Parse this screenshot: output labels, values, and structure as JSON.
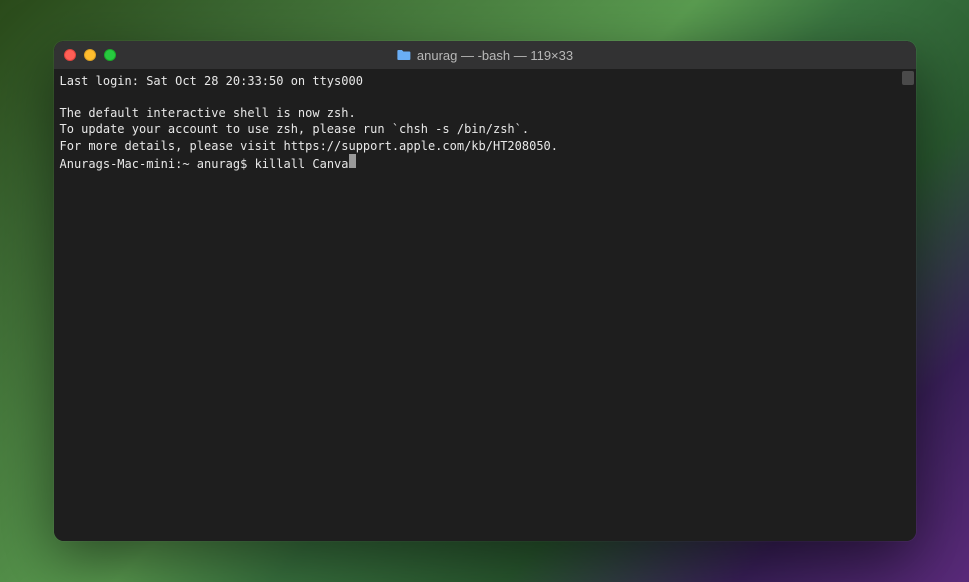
{
  "window": {
    "title": "anurag — -bash — 119×33"
  },
  "terminal": {
    "lines": {
      "last_login": "Last login: Sat Oct 28 20:33:50 on ttys000",
      "zsh_notice_1": "The default interactive shell is now zsh.",
      "zsh_notice_2": "To update your account to use zsh, please run `chsh -s /bin/zsh`.",
      "zsh_notice_3": "For more details, please visit https://support.apple.com/kb/HT208050."
    },
    "prompt": {
      "host_path": "Anurags-Mac-mini:~ anurag$ ",
      "command": "killall Canva"
    }
  },
  "icons": {
    "folder": "folder-icon"
  },
  "colors": {
    "terminal_bg": "#1e1e1e",
    "titlebar_bg": "#323233",
    "text": "#e8e8e8",
    "close": "#ff5f56",
    "minimize": "#ffbd2e",
    "maximize": "#27c93f"
  }
}
